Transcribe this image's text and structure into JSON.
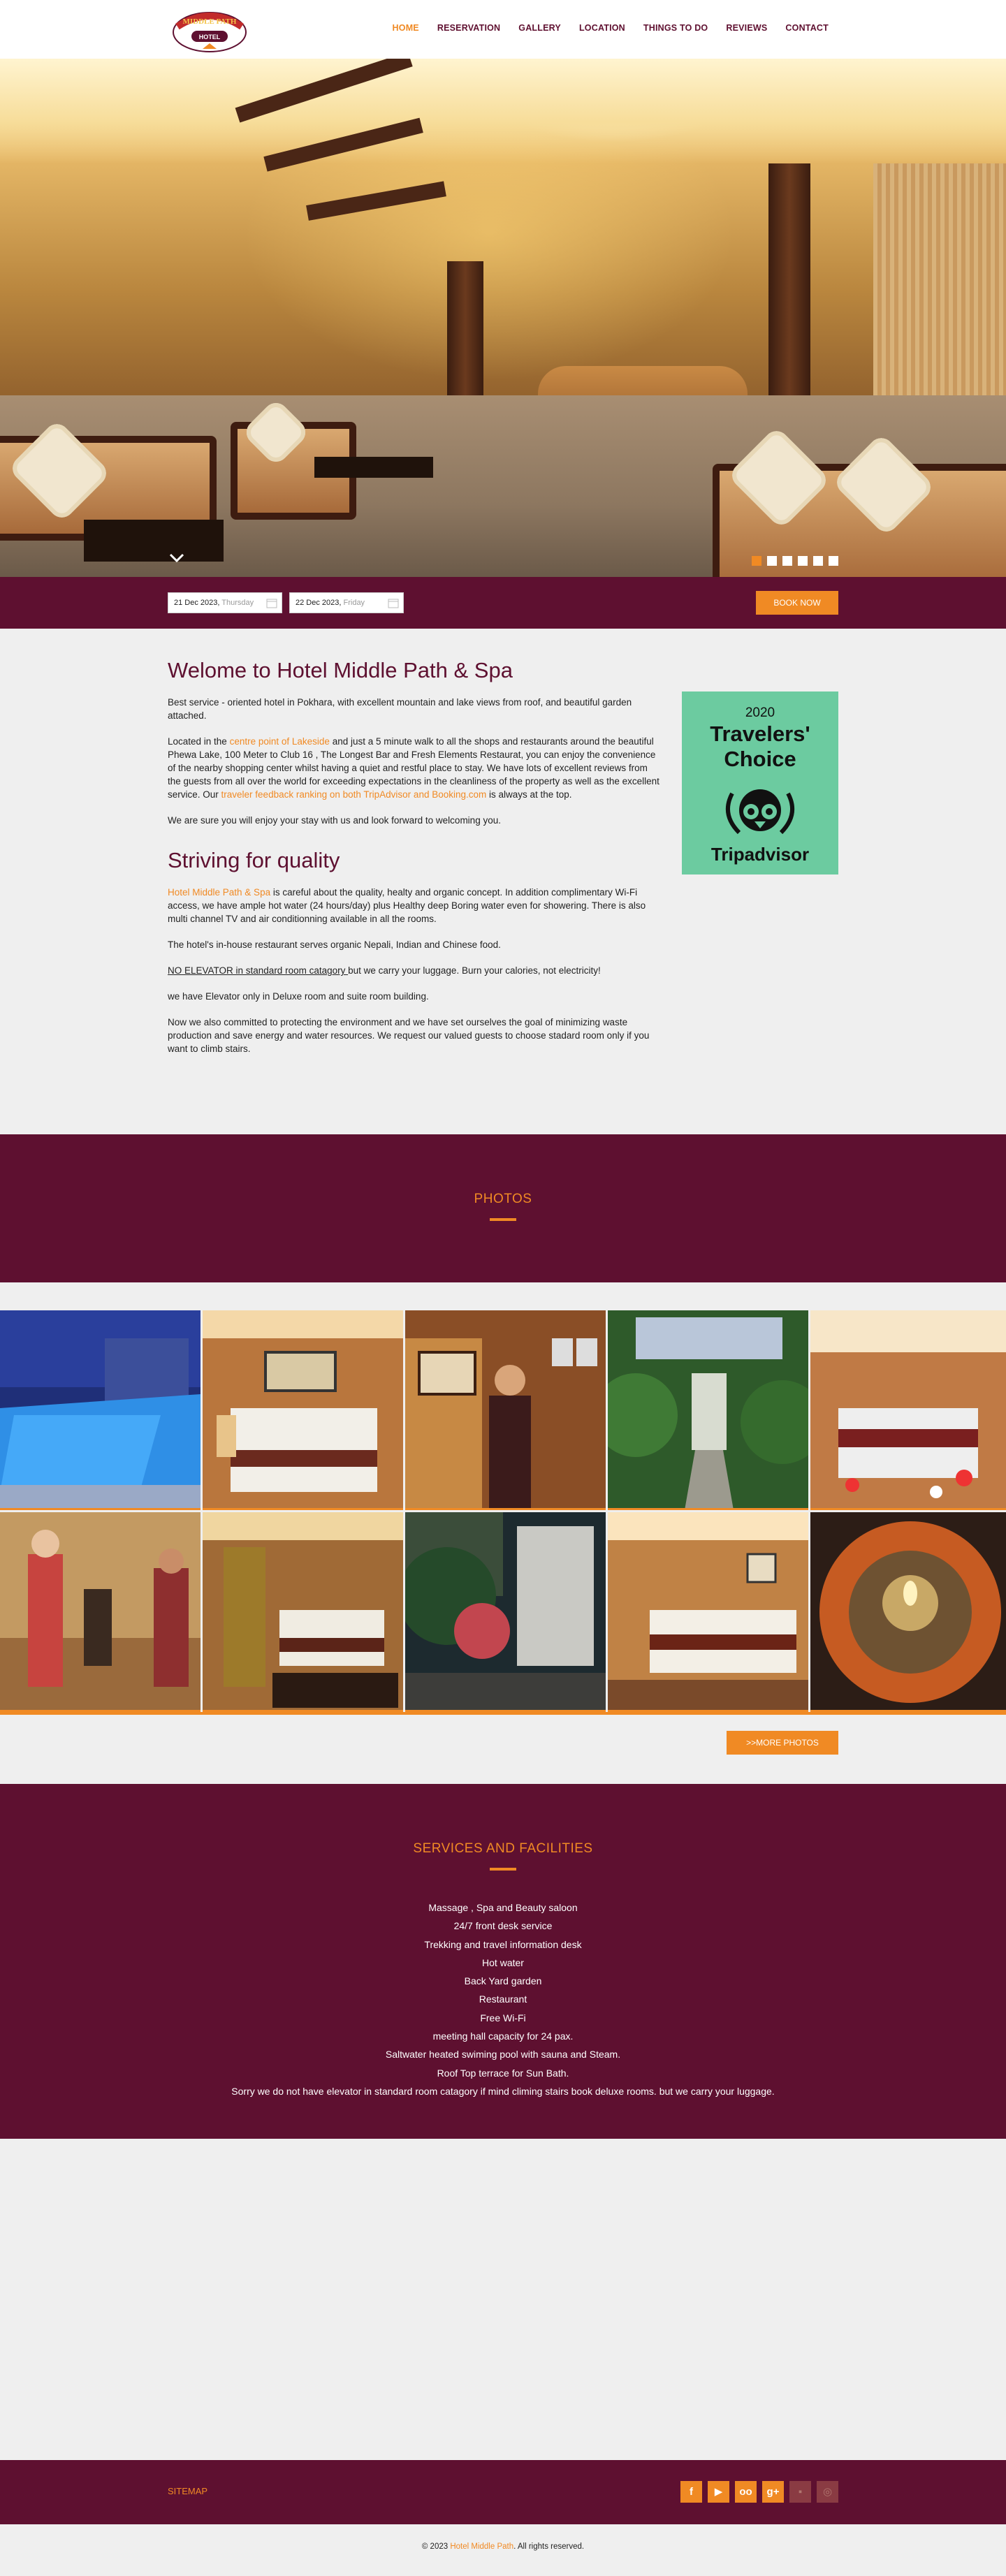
{
  "nav": {
    "items": [
      {
        "label": "HOME",
        "active": true
      },
      {
        "label": "RESERVATION"
      },
      {
        "label": "GALLERY"
      },
      {
        "label": "LOCATION"
      },
      {
        "label": "THINGS TO DO"
      },
      {
        "label": "REVIEWS"
      },
      {
        "label": "CONTACT"
      }
    ]
  },
  "logo": {
    "top": "MIDDLE PATH",
    "bottom": "HOTEL",
    "icon": "hotel-crest-icon"
  },
  "hero": {
    "dots": 6,
    "active_dot": 0
  },
  "booking": {
    "checkin_date": "21 Dec 2023,",
    "checkin_day": "Thursday",
    "checkout_date": "22 Dec 2023,",
    "checkout_day": "Friday",
    "book_label": "BOOK NOW"
  },
  "intro": {
    "title": "Welome to Hotel Middle Path & Spa",
    "p1": "Best  service - oriented hotel in Pokhara, with excellent mountain and lake views from roof, and beautiful garden attached.",
    "p2_a": "Located in the ",
    "p2_link": "centre point of Lakeside",
    "p2_b": " and just a 5 minute walk to all the shops and restaurants around the beautiful Phewa Lake, 100 Meter to Club 16 , The Longest Bar and Fresh Elements Restaurat,  you can enjoy the convenience of the nearby shopping center whilst having a quiet and restful place to stay. We have lots of excellent reviews from the guests from all over the world for exceeding expectations in the cleanliness of the property as well as the excellent service. Our ",
    "p2_link2": "traveler feedback ranking on both TripAdvisor and Booking.com",
    "p2_c": " is always at the top.",
    "p3": "We are sure you will enjoy your stay with us and look forward to welcoming you.",
    "quality_title": "Striving for quality",
    "q1_link": "Hotel Middle Path & Spa",
    "q1": " is careful about the quality, healty and organic concept. In addition complimentary Wi-Fi access, we have ample hot water (24 hours/day) plus Healthy deep Boring water even for showering. There is also multi channel TV and air conditionning available in all the rooms.",
    "q2": "The hotel's in-house restaurant serves organic Nepali, Indian and Chinese food.",
    "q3_u": "NO ELEVATOR in standard room catagory ",
    "q3": " but we carry your luggage. Burn your calories, not electricity!",
    "q4": "we have Elevator only  in Deluxe room and suite room building.",
    "q5": "Now we also  committed to protecting the environment  and we have set ourselves the goal of minimizing waste production and  save energy and water resources. We request our valued guests  to choose stadard room only if you want to climb stairs."
  },
  "badge": {
    "year": "2020",
    "line1": "Travelers'",
    "line2": "Choice",
    "brand": "Tripadvisor",
    "color": "#6ccba0"
  },
  "photos": {
    "title": "PHOTOS",
    "more_label": ">>MORE PHOTOS",
    "items": [
      {
        "name": "pool-photo"
      },
      {
        "name": "bedroom-photo"
      },
      {
        "name": "staff-greeting-photo"
      },
      {
        "name": "garden-entrance-photo"
      },
      {
        "name": "decorated-room-photo"
      },
      {
        "name": "reception-photo"
      },
      {
        "name": "twin-room-photo"
      },
      {
        "name": "building-garden-photo"
      },
      {
        "name": "double-room-photo"
      },
      {
        "name": "flower-lamp-photo"
      }
    ]
  },
  "services": {
    "title": "SERVICES AND FACILITIES",
    "items": [
      "Massage ,  Spa and Beauty saloon",
      "24/7 front desk service",
      "Trekking and travel information desk",
      "Hot water",
      "Back Yard garden",
      "Restaurant",
      "Free Wi-Fi",
      "meeting hall capacity for 24 pax.",
      "Saltwater heated swiming pool  with sauna and Steam.",
      "Roof Top terrace for Sun Bath.",
      "Sorry we do not have elevator in standard room catagory if mind climing stairs book deluxe rooms. but we carry your luggage."
    ]
  },
  "footer": {
    "sitemap": "SITEMAP",
    "socials": [
      {
        "icon": "facebook-icon",
        "glyph": "f"
      },
      {
        "icon": "youtube-icon",
        "glyph": "▶"
      },
      {
        "icon": "tripadvisor-icon",
        "glyph": "oo"
      },
      {
        "icon": "googleplus-icon",
        "glyph": "g+"
      },
      {
        "icon": "foursquare-icon",
        "glyph": "▪"
      },
      {
        "icon": "instagram-icon",
        "glyph": "◎"
      }
    ],
    "copy_a": "© 2023 ",
    "copy_link": "Hotel Middle Path",
    "copy_b": ". All rights reserved."
  },
  "colors": {
    "brand": "#5e1030",
    "accent": "#f08a24",
    "background": "#efefef"
  }
}
